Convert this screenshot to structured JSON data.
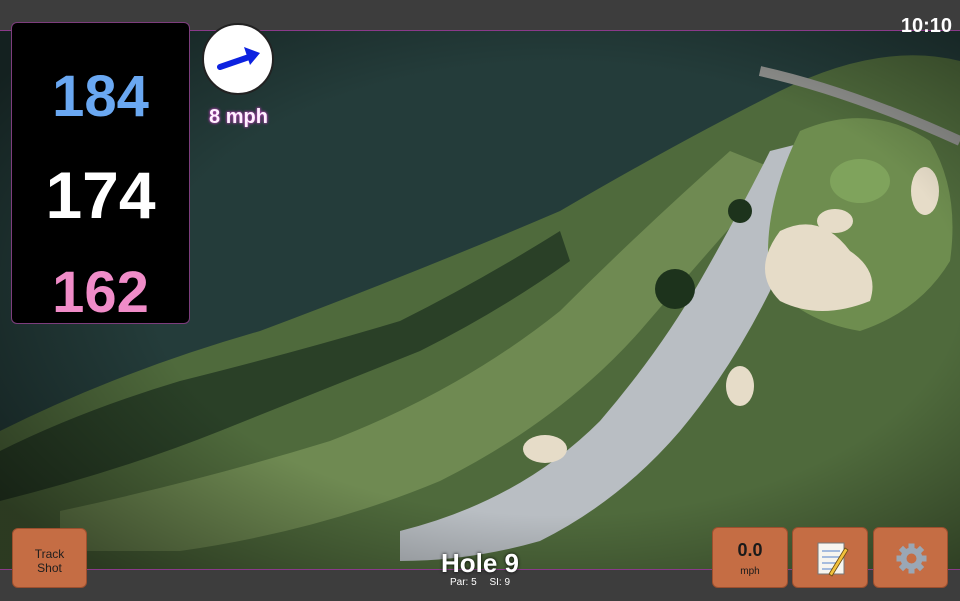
{
  "clock": "10:10",
  "distances": {
    "back": "184",
    "middle": "174",
    "front": "162"
  },
  "wind": {
    "speed": "8 mph",
    "icon": "wind-arrow-icon",
    "direction": "north-east"
  },
  "hole": {
    "title": "Hole 9",
    "par": "Par: 5",
    "stroke_index": "SI: 9"
  },
  "buttons": {
    "track_shot_line1": "Track",
    "track_shot_line2": "Shot",
    "speed_value": "0.0",
    "speed_unit": "mph",
    "notes_icon": "notepad-icon",
    "settings_icon": "gear-icon"
  },
  "colors": {
    "back": "#6aa8f2",
    "middle": "#ffffff",
    "front": "#f08cc8",
    "button": "#c56d44",
    "border_accent": "#8a3a8a"
  }
}
